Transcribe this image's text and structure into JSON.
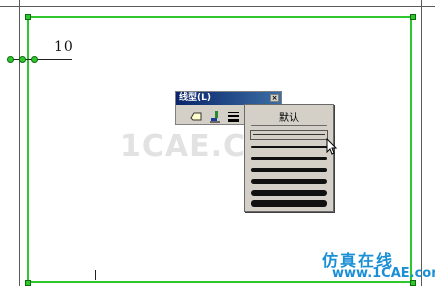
{
  "drawing": {
    "dimension_text": "10"
  },
  "palette": {
    "title": "线型(L)",
    "close_glyph": "×",
    "tools": [
      "shape-icon",
      "brush-icon",
      "lineweight-icon"
    ]
  },
  "linetype_dropdown": {
    "default_label": "默认",
    "selected_index": 0,
    "items": [
      "default",
      "weight-1",
      "weight-2",
      "weight-3",
      "weight-4",
      "weight-5",
      "weight-6",
      "weight-7"
    ]
  },
  "watermark": {
    "center": "1CAE.COM",
    "bottom_title": "仿真在线",
    "bottom_url": "www.1CAE.com"
  },
  "colors": {
    "selection_green": "#2ec82e",
    "dialog_gray": "#d4d0c8",
    "title_blue": "#0a246a",
    "watermark_blue": "#1a8fd6"
  }
}
